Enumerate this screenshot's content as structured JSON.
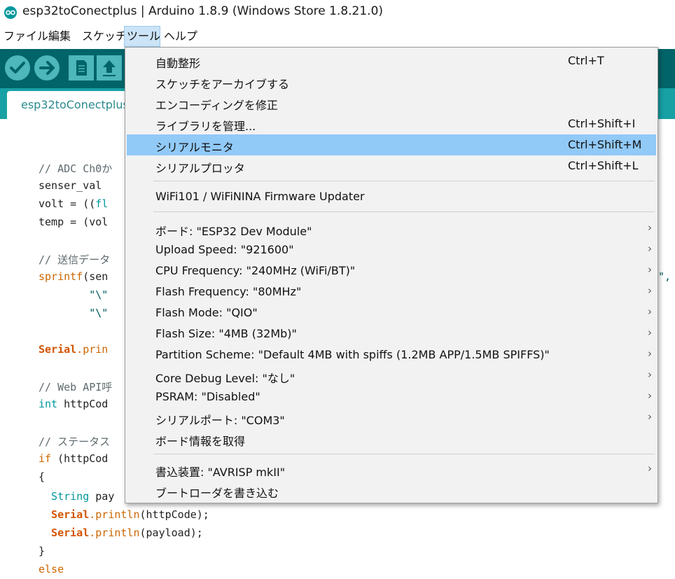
{
  "window": {
    "title": "esp32toConectplus | Arduino 1.8.9 (Windows Store 1.8.21.0)"
  },
  "menubar": {
    "file": "ファイル",
    "edit": "編集",
    "sketch": "スケッチ",
    "tools": "ツール",
    "help": "ヘルプ"
  },
  "toolbar": {
    "verify_icon": "check-icon",
    "upload_icon": "arrow-right-icon",
    "new_icon": "file-icon",
    "open_icon": "open-arrow-icon"
  },
  "tab": {
    "label": "esp32toConectplus"
  },
  "colors": {
    "toolbar_bg": "#006468",
    "tabstrip_bg": "#17a1a5",
    "highlight": "#91c9f7"
  },
  "code": {
    "l1": "// ADC Ch0か",
    "l2": "senser_val",
    "l3a": "volt = ((",
    "l3b": "fl",
    "l4": "temp = (vol",
    "l5": "// 送信データ",
    "l6a": "sprintf",
    "l6b": "(sen",
    "l6c": "\",",
    "l7": "        \"\\\"",
    "l8": "        \"\\\"",
    "l9a": "Serial",
    "l9b": ".prin",
    "l10": "// Web API呼",
    "l11a": "int",
    "l11b": " httpCod",
    "l12": "// ステータス",
    "l13a": "if",
    "l13b": " (httpCod",
    "l14": "{",
    "l15a": "  String",
    "l15b": " pay",
    "l16a": "  Serial",
    "l16b": ".println",
    "l16c": "(httpCode);",
    "l17a": "  Serial",
    "l17b": ".println",
    "l17c": "(payload);",
    "l18": "}",
    "l19": "else"
  },
  "tools_menu": {
    "autoformat": {
      "label": "自動整形",
      "shortcut": "Ctrl+T"
    },
    "archive": {
      "label": "スケッチをアーカイブする"
    },
    "fix_encoding": {
      "label": "エンコーディングを修正"
    },
    "manage_libraries": {
      "label": "ライブラリを管理...",
      "shortcut": "Ctrl+Shift+I"
    },
    "serial_monitor": {
      "label": "シリアルモニタ",
      "shortcut": "Ctrl+Shift+M"
    },
    "serial_plotter": {
      "label": "シリアルプロッタ",
      "shortcut": "Ctrl+Shift+L"
    },
    "firmware_updater": {
      "label": "WiFi101 / WiFiNINA Firmware Updater"
    },
    "board": {
      "label": "ボード: \"ESP32 Dev Module\""
    },
    "upload_speed": {
      "label": "Upload Speed: \"921600\""
    },
    "cpu_freq": {
      "label": "CPU Frequency: \"240MHz (WiFi/BT)\""
    },
    "flash_freq": {
      "label": "Flash Frequency: \"80MHz\""
    },
    "flash_mode": {
      "label": "Flash Mode: \"QIO\""
    },
    "flash_size": {
      "label": "Flash Size: \"4MB (32Mb)\""
    },
    "partition": {
      "label": "Partition Scheme: \"Default 4MB with spiffs (1.2MB APP/1.5MB SPIFFS)\""
    },
    "debug_level": {
      "label": "Core Debug Level: \"なし\""
    },
    "psram": {
      "label": "PSRAM: \"Disabled\""
    },
    "port": {
      "label": "シリアルポート: \"COM3\""
    },
    "board_info": {
      "label": "ボード情報を取得"
    },
    "programmer": {
      "label": "書込装置: \"AVRISP mkII\""
    },
    "burn_bootloader": {
      "label": "ブートローダを書き込む"
    },
    "submenu_arrow": "›"
  }
}
